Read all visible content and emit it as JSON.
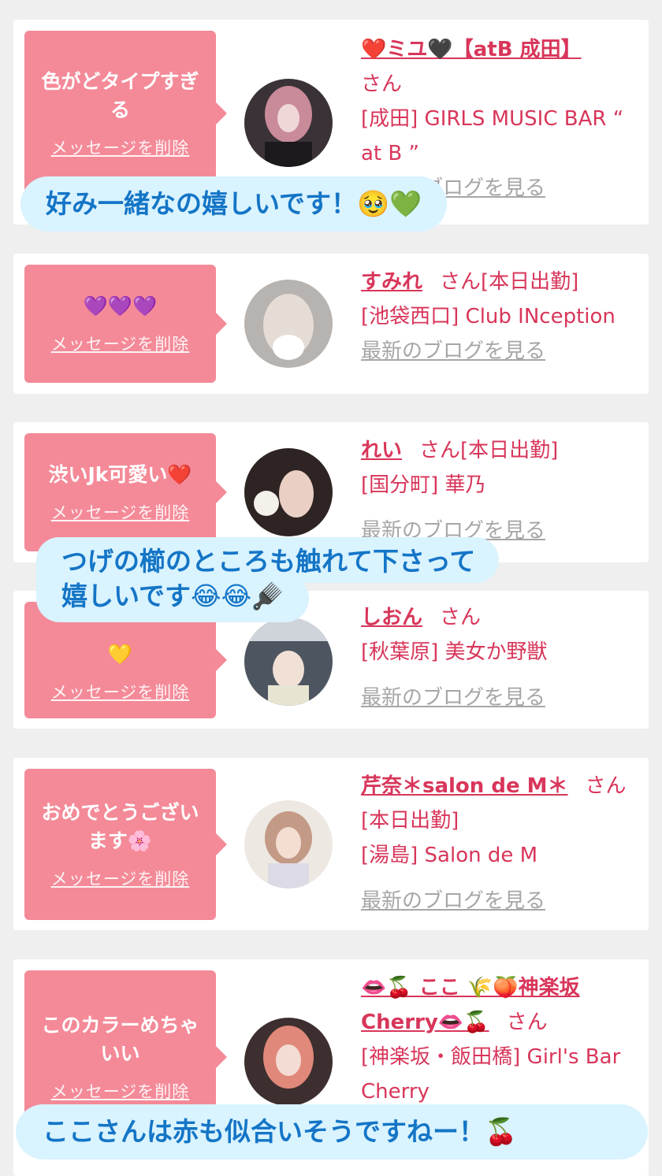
{
  "delete_label": "メッセージを削除",
  "blog_label": "最新のブログを見る",
  "san": "さん",
  "cards": [
    {
      "message": "色がどタイプすぎる",
      "name": "❤️ミユ🖤【atB 成田】",
      "attendance": "",
      "shop": "[成田] GIRLS MUSIC BAR “ at B ”",
      "show_blog": true
    },
    {
      "message": "💜💜💜",
      "name": "すみれ",
      "attendance": "[本日出勤]",
      "shop": "[池袋西口] Club INception",
      "show_blog": true
    },
    {
      "message": "渋いJk可愛い❤️",
      "name": "れい",
      "attendance": "[本日出勤]",
      "shop": "[国分町] 華乃",
      "show_blog": true
    },
    {
      "message": "💛",
      "name": "しおん",
      "attendance": "",
      "shop": "[秋葉原] 美女か野獣",
      "show_blog": true
    },
    {
      "message": "おめでとうございます🌸",
      "name": "芹奈＊salon de M＊",
      "attendance": "[本日出勤]",
      "shop": "[湯島] Salon de M",
      "show_blog": true
    },
    {
      "message": "このカラーめちゃいい",
      "name": "👄🍒 ここ 🌾🍑神楽坂Cherry👄🍒",
      "attendance": "",
      "shop": "[神楽坂・飯田橋] Girl's Bar Cherry",
      "show_blog": false
    }
  ],
  "captions": [
    "好み一緒なの嬉しいです！🥹💚",
    "つげの櫛のところも触れて下さって",
    "嬉しいです😂😂🪮",
    "ここさんは赤も似合いそうですねー！🍒"
  ],
  "colors": {
    "bubble": "#f48a98",
    "name": "#d8365a",
    "caption_bg": "#d9f3ff",
    "caption_text": "#1475c6"
  }
}
